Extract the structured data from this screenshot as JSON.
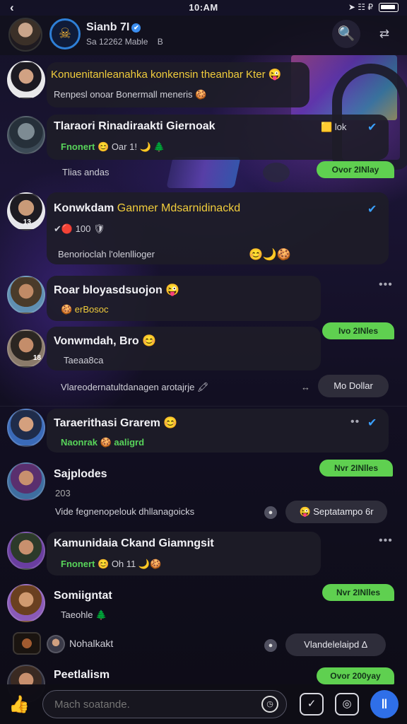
{
  "colors": {
    "accent": "#3aa0ff",
    "green": "#5fd050",
    "background": "#0c0b14",
    "card": "#1e1d28"
  },
  "status_bar": {
    "back_icon": "chevron-left",
    "time": "10:AM",
    "right_text": "➤ ☷ ₽"
  },
  "header": {
    "title": "Sianb 7I",
    "subtitle": "Sa 12262 Mable",
    "subtitle_icon": "B",
    "verified_icon": "✔",
    "logo_glyph": "☠",
    "search_icon": "🔍",
    "share_icon": "⇄"
  },
  "chats": [
    {
      "name": "Konuenitanleanahka konkensin theanbar Kter 😜",
      "line1": "Renpesl onoar Bonermall meneris 🍪"
    },
    {
      "name": "Tlaraori Rinadiraakti Giernoak",
      "line1_green": "Fnonert",
      "line1_rest": "😊 Oar 1! 🌙 🌲",
      "right_tag": "🟨 lok",
      "tick": "✔",
      "line2": "Tlias andas",
      "pill": "Ovor 2INlay"
    },
    {
      "name": "Konwkdam",
      "name_yellow": "Ganmer Mdsarnidinackd",
      "line1": "✔🔴 100 🛡",
      "tick": "✔",
      "line2": "Benorioclah l'olenllioger",
      "line2_icons": "😊🌙🍪"
    },
    {
      "name": "Roar bloyasdsuojon 😜",
      "line1": "🍪 erBosoc",
      "dots": "•••",
      "pill": "Ivo 2INles"
    },
    {
      "name": "Vonwmdah, Bro 😊",
      "line1": "Taeaa8ca",
      "badge": "18",
      "line2": "Vlareodernatultdanagen arotajrje 🖍",
      "link_icon": "↔",
      "pill_dark": "Mo Dollar"
    },
    {
      "name": "Taraerithasi Grarem 😊",
      "line1": "Naonrak 🍪 aaligrd",
      "dots": "••",
      "tick": "✔",
      "pill": "Nvr 2INlles"
    },
    {
      "name": "Sajplodes",
      "line1": "203",
      "line2": "Vide fegnenopelouk dhllanagoicks",
      "pill_dark": "Septatampo 6r",
      "pill_icon": "😜"
    },
    {
      "name": "Kamunidaia Ckand Giamngsit",
      "line1_green": "Fnonert",
      "line1_rest": "😊 Oh 11 🌙🍪",
      "dots": "•••",
      "pill": "Nvr 2INlles"
    },
    {
      "name": "Somiigntat",
      "line1": "Taeohle 🌲"
    },
    {
      "name": "Nohalkakt",
      "pill_dark": "Vlandelelaipd ∆"
    },
    {
      "name": "Peetlalism",
      "pill": "Ovor 200yay"
    }
  ],
  "composer": {
    "like_icon": "👍",
    "placeholder": "Mach soatande.",
    "clock_icon": "◷",
    "check_icon": "✓",
    "camera_icon": "◎",
    "send_icon": "‖"
  }
}
